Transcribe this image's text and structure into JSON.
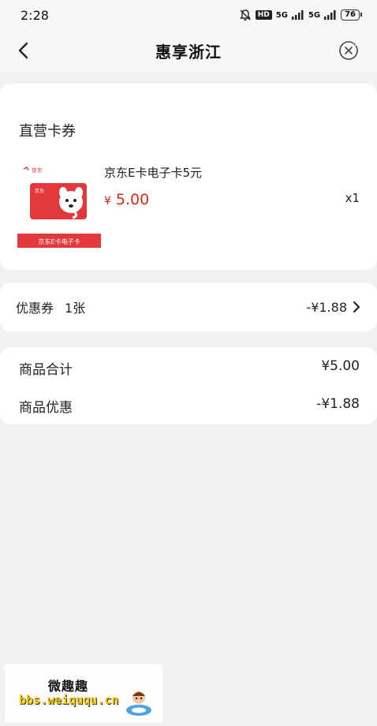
{
  "status": {
    "time": "2:28",
    "hd": "HD",
    "net1": "5G",
    "net2": "5G",
    "battery": "76"
  },
  "nav": {
    "title": "惠享浙江",
    "back_icon": "chevron-left-icon",
    "close_icon": "close-circle-icon"
  },
  "goods": {
    "section_title": "直营卡券",
    "product": {
      "name": "京东E卡电子卡5元",
      "price_symbol": "¥",
      "price": "5.00",
      "qty": "x1",
      "thumb_brand": "京东",
      "thumb_caption": "京东E卡电子卡"
    }
  },
  "coupon": {
    "label": "优惠券",
    "count": "1张",
    "discount": "-¥1.88"
  },
  "summary": {
    "total_label": "商品合计",
    "total_value": "¥5.00",
    "discount_label": "商品优惠",
    "discount_value": "-¥1.88"
  },
  "watermark": {
    "title": "微趣趣",
    "url": "bbs.weiququ.cn"
  },
  "colors": {
    "price_red": "#e2231a",
    "jd_red": "#e4393c",
    "bg": "#f2f2f2"
  }
}
